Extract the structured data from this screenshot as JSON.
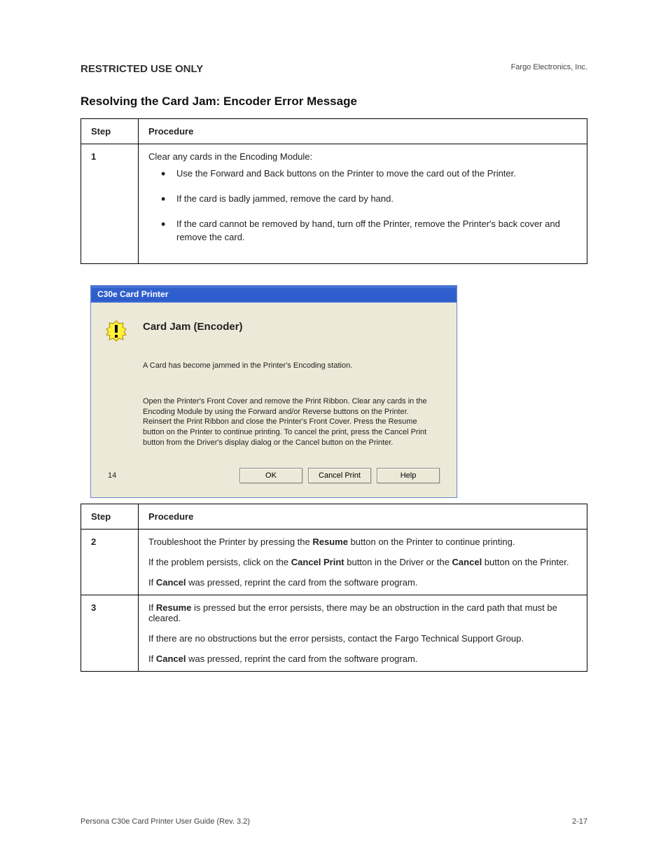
{
  "header": {
    "restricted": "RESTRICTED USE ONLY",
    "company": "Fargo Electronics, Inc."
  },
  "section_title": "Resolving the Card Jam: Encoder Error Message",
  "table1": {
    "col_head_1": "Step",
    "col_head_2": "Procedure",
    "row1_step": "1",
    "row1_intro": "Clear any cards in the Encoding Module:",
    "bullets": [
      "Use the Forward and Back buttons on the Printer to move the card out of the Printer.",
      "If the card is badly jammed, remove the card by hand.",
      "If the card cannot be removed by hand, turn off the Printer, remove the Printer's back cover and remove the card."
    ]
  },
  "dialog": {
    "title": "C30e Card Printer",
    "heading": "Card Jam (Encoder)",
    "message": "A Card has become jammed in the Printer's Encoding station.",
    "instructions": "Open the Printer's Front Cover and remove the Print Ribbon. Clear any cards in the Encoding Module by using the Forward and/or Reverse buttons on the Printer. Reinsert the Print Ribbon and close the Printer's Front Cover. Press the Resume button on the Printer to continue printing. To cancel the print, press the Cancel Print button from the Driver's display dialog or the Cancel button on the Printer.",
    "error_code": "14",
    "buttons": {
      "ok": "OK",
      "cancel_print": "Cancel Print",
      "help": "Help"
    }
  },
  "table2": {
    "col_head_1": "Step",
    "col_head_2": "Procedure",
    "row2_step": "2",
    "row2_text_a": "Troubleshoot the Printer by pressing the ",
    "row2_bold_a": "Resume",
    "row2_text_b": " button on the Printer to continue printing.",
    "row2_line2_a": "If the problem persists, click on the ",
    "row2_bold_b": "Cancel Print",
    "row2_line2_b": " button in the Driver or the ",
    "row2_bold_c": "Cancel",
    "row2_line2_c": " button on the Printer.",
    "row2_line3_a": "If ",
    "row2_bold_d": "Cancel",
    "row2_line3_b": " was pressed, reprint the card from the software program.",
    "row3_step": "3",
    "row3_text_a": "If ",
    "row3_bold_a": "Resume",
    "row3_text_b": " is pressed but the error persists, there may be an obstruction in the card path that must be cleared.",
    "row3_line2": "If there are no obstructions but the error persists, contact the Fargo Technical Support Group.",
    "row3_line3_a": "If ",
    "row3_bold_b": "Cancel",
    "row3_line3_b": " was pressed, reprint the card from the software program."
  },
  "footer": {
    "left": "Persona C30e Card Printer User Guide (Rev. 3.2)",
    "right": "2-17"
  }
}
